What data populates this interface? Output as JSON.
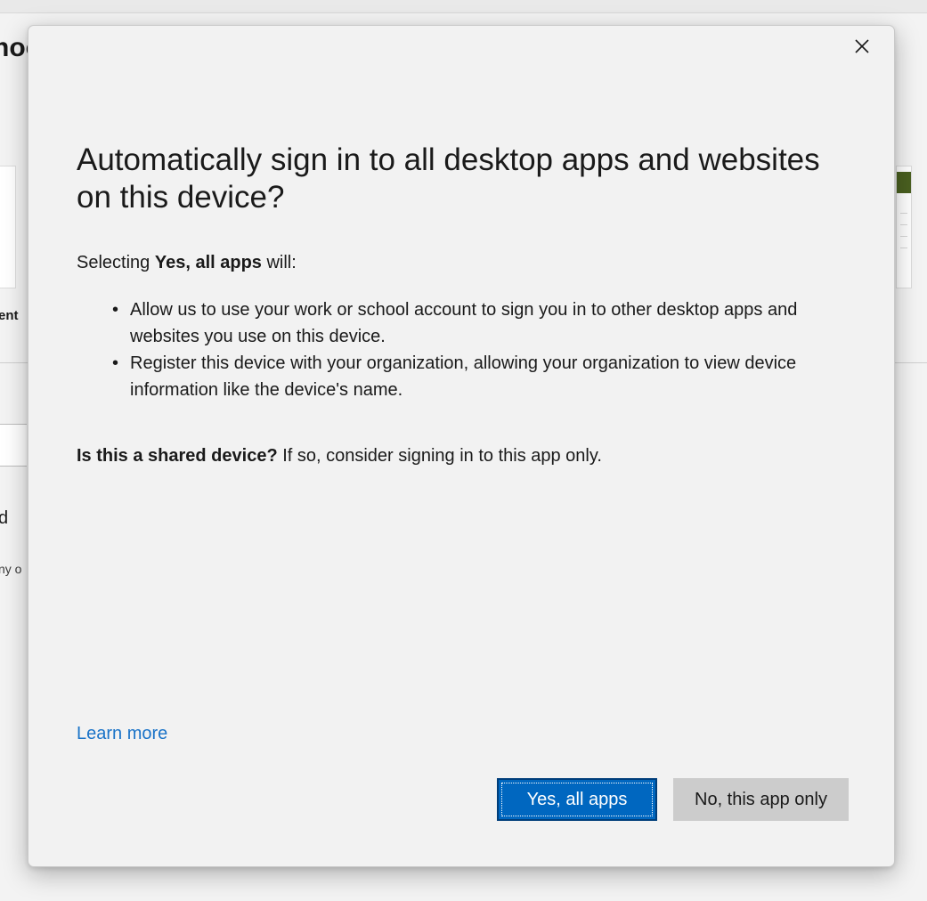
{
  "background": {
    "title_fragment": "hoo",
    "card_label_fragment": "ent",
    "text_fragment_1": "d",
    "text_fragment_2": "ny o"
  },
  "dialog": {
    "close_icon": "close-icon",
    "heading": "Automatically sign in to all desktop apps and websites on this device?",
    "intro": {
      "prefix": "Selecting ",
      "bold": "Yes, all apps",
      "suffix": " will:"
    },
    "bullets": [
      {
        "marker": "•",
        "text": "Allow us to use your work or school account to sign you in to other desktop apps and websites you use on this device."
      },
      {
        "marker": "•",
        "text": "Register this device with your organization, allowing your organization to view device information like the device's name."
      }
    ],
    "shared_device": {
      "bold": "Is this a shared device?",
      "rest": " If so, consider signing in to this app only."
    },
    "learn_more": "Learn more",
    "buttons": {
      "primary": "Yes, all apps",
      "secondary": "No, this app only"
    }
  },
  "colors": {
    "dialog_background": "#f2f2f2",
    "primary_button": "#0067c0",
    "secondary_button": "#cccccc",
    "link": "#1a73c8"
  }
}
